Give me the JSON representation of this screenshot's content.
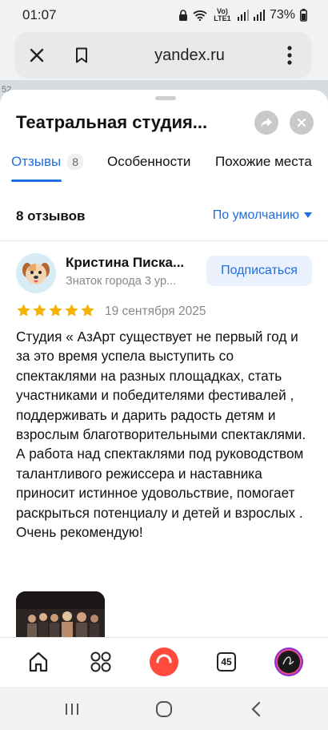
{
  "status": {
    "time": "01:07",
    "network": "Vo) LTE1",
    "battery": "73%"
  },
  "browser": {
    "url": "yandex.ru"
  },
  "map": {
    "number": "52"
  },
  "place": {
    "title": "Театральная студия...",
    "tabs": [
      {
        "label": "Отзывы",
        "count": "8"
      },
      {
        "label": "Особенности"
      },
      {
        "label": "Похожие места"
      }
    ]
  },
  "reviews": {
    "count_label": "8 отзывов",
    "sort_label": "По умолчанию",
    "item": {
      "author": "Кристина Писка...",
      "subtitle": "Знаток города 3 ур...",
      "subscribe_label": "Подписаться",
      "rating": 5,
      "date": "19 сентября 2025",
      "text": "Студия « АзАрт существует не первый год и за это время успела выступить со спектаклями на разных площадках, стать участниками и победителями фестивалей , поддерживать и дарить радость детям и взрослым благотворительными спектаклями. А работа над спектаклями под руководством талантливого режиссера и наставника приносит истинное удовольствие, помогает раскрыться потенциалу и детей и взрослых . Очень рекомендую!"
    }
  },
  "bottom_nav": {
    "tabs_count": "45"
  },
  "colors": {
    "accent": "#1e6fe0",
    "star": "#f4b400",
    "alice": "#ff4a3d"
  }
}
